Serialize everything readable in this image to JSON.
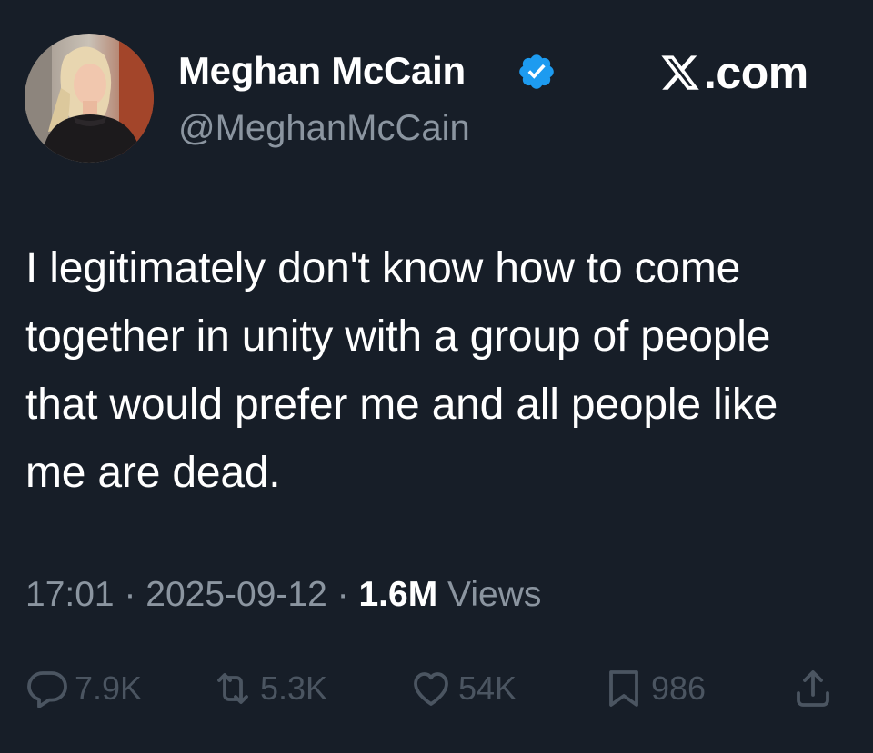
{
  "author": {
    "display_name": "Meghan McCain",
    "handle": "@MeghanMcCain",
    "verified": true,
    "verified_color": "#1d9bf0",
    "avatar_icon": "profile-photo"
  },
  "brand": {
    "text": ".com",
    "logo_icon": "x-logo-icon"
  },
  "tweet": {
    "text": "I legitimately don't know how to come together in unity with a group of people that would prefer me and all people like me are dead."
  },
  "meta": {
    "time": "17:01",
    "separator": "·",
    "date": "2025-09-12",
    "views_count": "1.6M",
    "views_label": "Views"
  },
  "actions": {
    "replies": "7.9K",
    "reposts": "5.3K",
    "likes": "54K",
    "bookmarks": "986"
  },
  "colors": {
    "background": "#171e28",
    "text_primary": "#ffffff",
    "text_secondary": "#8b95a0",
    "icon_dim": "#4b5561"
  }
}
